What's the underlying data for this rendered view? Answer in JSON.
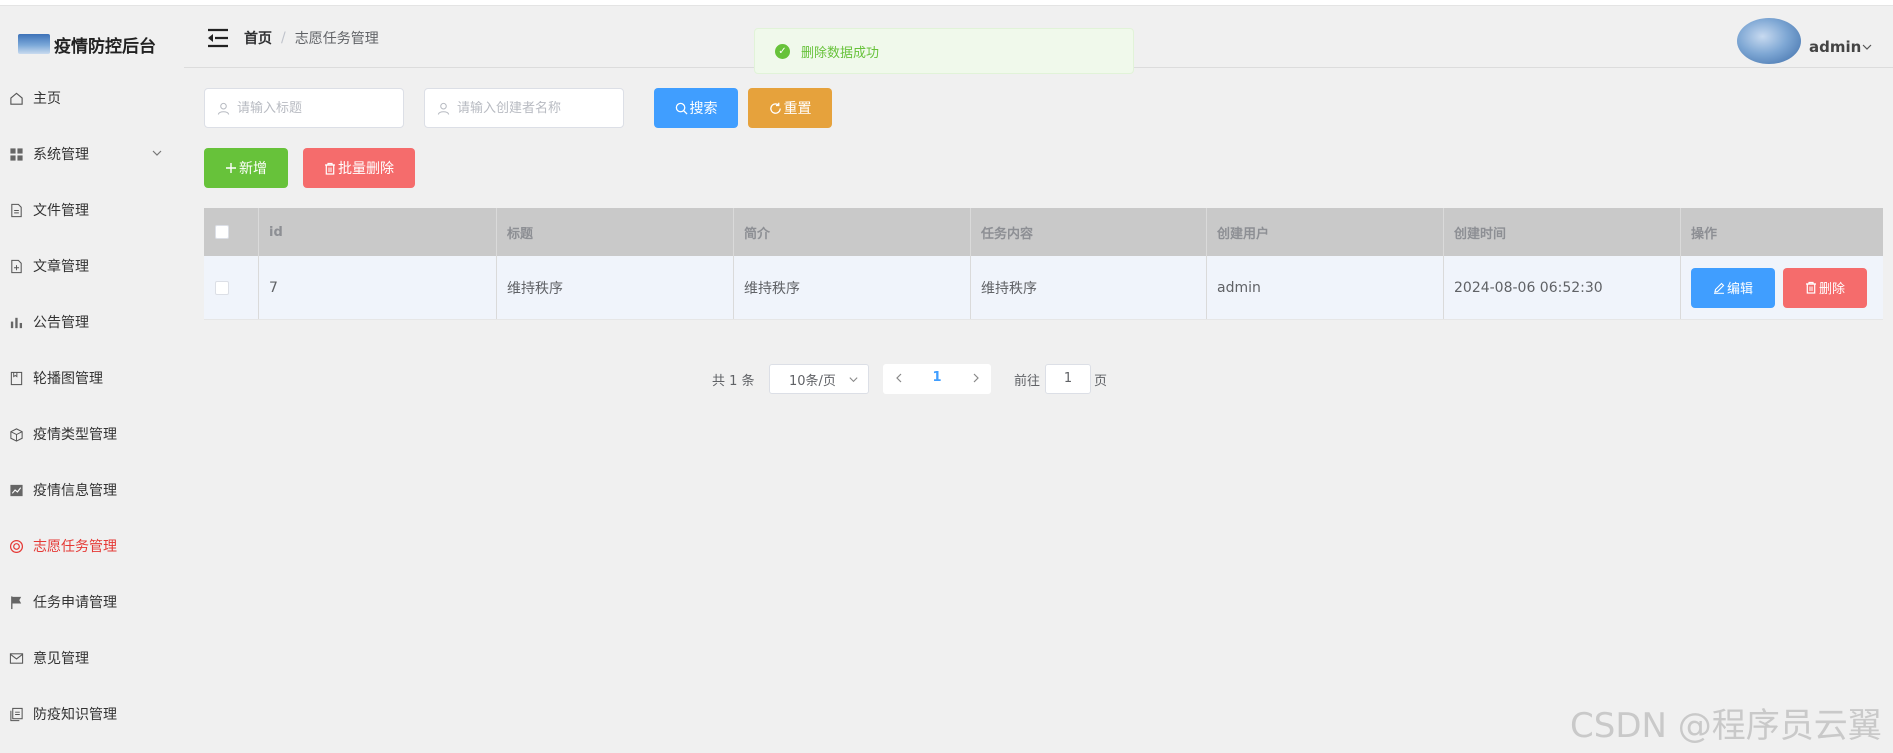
{
  "app": {
    "title": "疫情防控后台"
  },
  "sidebar": {
    "items": [
      {
        "label": "主页",
        "icon": "home-icon"
      },
      {
        "label": "系统管理",
        "icon": "grid-icon",
        "has_children": true
      },
      {
        "label": "文件管理",
        "icon": "document-icon"
      },
      {
        "label": "文章管理",
        "icon": "document-add-icon"
      },
      {
        "label": "公告管理",
        "icon": "bar-chart-icon"
      },
      {
        "label": "轮播图管理",
        "icon": "notebook-icon"
      },
      {
        "label": "疫情类型管理",
        "icon": "box-icon"
      },
      {
        "label": "疫情信息管理",
        "icon": "data-line-icon"
      },
      {
        "label": "志愿任务管理",
        "icon": "help-ring-icon",
        "active": true
      },
      {
        "label": "任务申请管理",
        "icon": "flag-icon"
      },
      {
        "label": "意见管理",
        "icon": "message-icon"
      },
      {
        "label": "防疫知识管理",
        "icon": "copy-document-icon"
      }
    ]
  },
  "header": {
    "breadcrumb": {
      "home": "首页",
      "separator": "/",
      "current": "志愿任务管理"
    },
    "user": {
      "name": "admin"
    }
  },
  "toast": {
    "message": "删除数据成功",
    "type": "success"
  },
  "search": {
    "title_placeholder": "请输入标题",
    "creator_placeholder": "请输入创建者名称",
    "search_label": "搜索",
    "reset_label": "重置"
  },
  "toolbar": {
    "add_label": "新增",
    "batch_delete_label": "批量删除"
  },
  "table": {
    "columns": [
      "id",
      "标题",
      "简介",
      "任务内容",
      "创建用户",
      "创建时间",
      "操作"
    ],
    "rows": [
      {
        "id": "7",
        "title": "维持秩序",
        "intro": "维持秩序",
        "content": "维持秩序",
        "creator": "admin",
        "created_at": "2024-08-06 06:52:30"
      }
    ],
    "edit_label": "编辑",
    "delete_label": "删除"
  },
  "pagination": {
    "total_text": "共 1 条",
    "page_size": "10条/页",
    "current_page": "1",
    "goto_label": "前往",
    "goto_value": "1",
    "page_suffix": "页"
  },
  "watermark": "CSDN @程序员云翼",
  "colors": {
    "primary": "#409eff",
    "success": "#67c23a",
    "warning": "#e6a23c",
    "danger": "#f56c6c",
    "active_menu": "#e53935"
  }
}
